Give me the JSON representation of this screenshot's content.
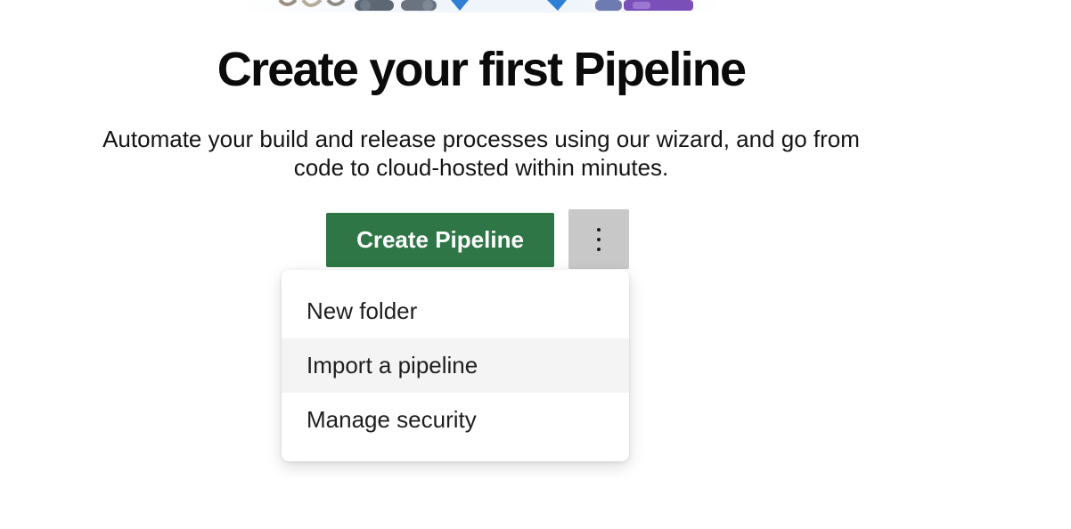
{
  "hero": {
    "image_name": "pipeline-illustration"
  },
  "main": {
    "title": "Create your first Pipeline",
    "subtitle_line1": "Automate your build and release processes using our wizard, and go from",
    "subtitle_line2": "code to cloud-hosted within minutes."
  },
  "actions": {
    "create_label": "Create Pipeline",
    "create_color": "#2e7645",
    "more_icon": "more-vertical-icon"
  },
  "menu": {
    "items": [
      {
        "label": "New folder",
        "highlighted": false
      },
      {
        "label": "Import a pipeline",
        "highlighted": true
      },
      {
        "label": "Manage security",
        "highlighted": false
      }
    ]
  }
}
